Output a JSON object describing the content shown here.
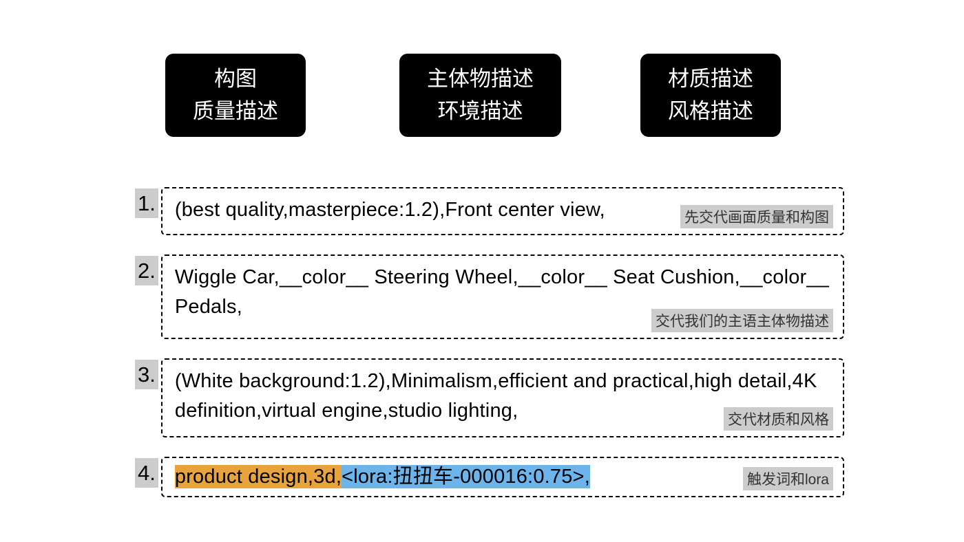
{
  "headers": [
    {
      "line1": "构图",
      "line2": "质量描述"
    },
    {
      "line1": "主体物描述",
      "line2": "环境描述"
    },
    {
      "line1": "材质描述",
      "line2": "风格描述"
    }
  ],
  "prompts": [
    {
      "number": "1.",
      "text": "(best quality,masterpiece:1.2),Front center view,",
      "label": "先交代画面质量和构图"
    },
    {
      "number": "2.",
      "text": "Wiggle Car,__color__ Steering Wheel,__color__ Seat Cushion,__color__ Pedals,",
      "label": "交代我们的主语主体物描述"
    },
    {
      "number": "3.",
      "text": "(White background:1.2),Minimalism,efficient and practical,high detail,4K definition,virtual engine,studio lighting,",
      "label": "交代材质和风格"
    },
    {
      "number": "4.",
      "text_orange": "product design,3d,",
      "text_blue": "<lora:扭扭车-000016:0.75>,",
      "label": "触发词和lora"
    }
  ]
}
